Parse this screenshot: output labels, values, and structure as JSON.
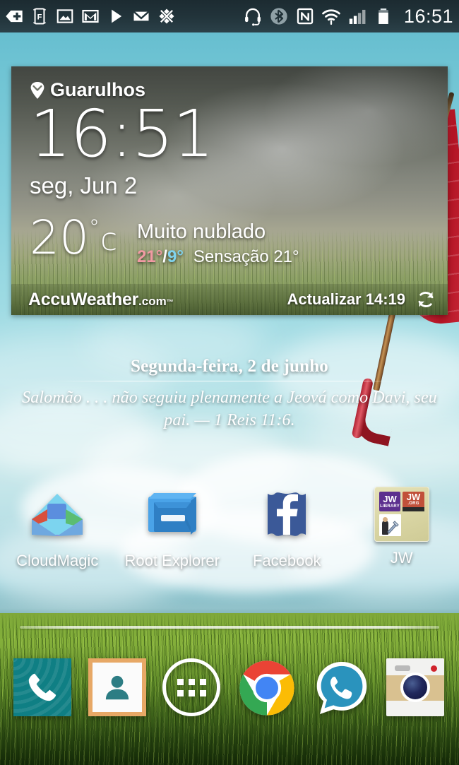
{
  "statusbar": {
    "time": "16:51",
    "left_icons": [
      {
        "name": "tag-plus-icon",
        "label": "tag-plus"
      },
      {
        "name": "f-frame-icon",
        "label": "F"
      },
      {
        "name": "gallery-image-icon",
        "label": "gallery"
      },
      {
        "name": "gmail-icon",
        "label": "M"
      },
      {
        "name": "play-icon",
        "label": "play"
      },
      {
        "name": "email-envelope-icon",
        "label": "email"
      },
      {
        "name": "sync-x-icon",
        "label": "sync"
      }
    ],
    "right_icons": [
      {
        "name": "headset-icon",
        "label": "headset"
      },
      {
        "name": "bluetooth-icon",
        "label": "bluetooth"
      },
      {
        "name": "nfc-icon",
        "label": "NFC"
      },
      {
        "name": "wifi-icon",
        "label": "wifi"
      },
      {
        "name": "cellular-signal-icon",
        "label": "signal"
      },
      {
        "name": "battery-icon",
        "label": "battery"
      }
    ]
  },
  "weather_widget": {
    "location": "Guarulhos",
    "clock": "16:51",
    "date": "seg, Jun 2",
    "temperature": "20",
    "degree_symbol": "°",
    "unit": "c",
    "condition": "Muito nublado",
    "high": "21°",
    "separator": "/",
    "low": "9°",
    "feels_like": "Sensação 21°",
    "brand_main": "AccuWeather",
    "brand_tld": ".com",
    "brand_tm": "™",
    "update_label": "Actualizar 14:19",
    "refresh_icon": "refresh-icon",
    "colors": {
      "high": "#f19aa3",
      "low": "#7fd3ee"
    }
  },
  "daily_text": {
    "heading": "Segunda-feira, 2 de junho",
    "body": "Salomão . . . não seguiu plenamente a Jeová como Davi, seu pai. — 1 Reis 11:6."
  },
  "apps": [
    {
      "label": "CloudMagic",
      "icon": "cloudmagic-icon"
    },
    {
      "label": "Root Explorer",
      "icon": "root-explorer-icon"
    },
    {
      "label": "Facebook",
      "icon": "facebook-icon"
    },
    {
      "label": "JW",
      "icon": "jw-folder-icon",
      "folder_items": [
        {
          "title": "JW",
          "sub": "LIBRARY",
          "color": "#5c2f8e"
        },
        {
          "title": "JW",
          "sub": ".ORG",
          "color": "#c1503a"
        },
        {
          "title": "",
          "sub": "",
          "color": "#ffffff"
        }
      ]
    }
  ],
  "dock": [
    {
      "name": "phone",
      "icon": "phone-icon"
    },
    {
      "name": "contacts",
      "icon": "contacts-icon"
    },
    {
      "name": "app-drawer",
      "icon": "app-drawer-icon"
    },
    {
      "name": "chrome",
      "icon": "chrome-icon"
    },
    {
      "name": "whatsapp",
      "icon": "whatsapp-icon"
    },
    {
      "name": "camera",
      "icon": "camera-icon"
    }
  ]
}
